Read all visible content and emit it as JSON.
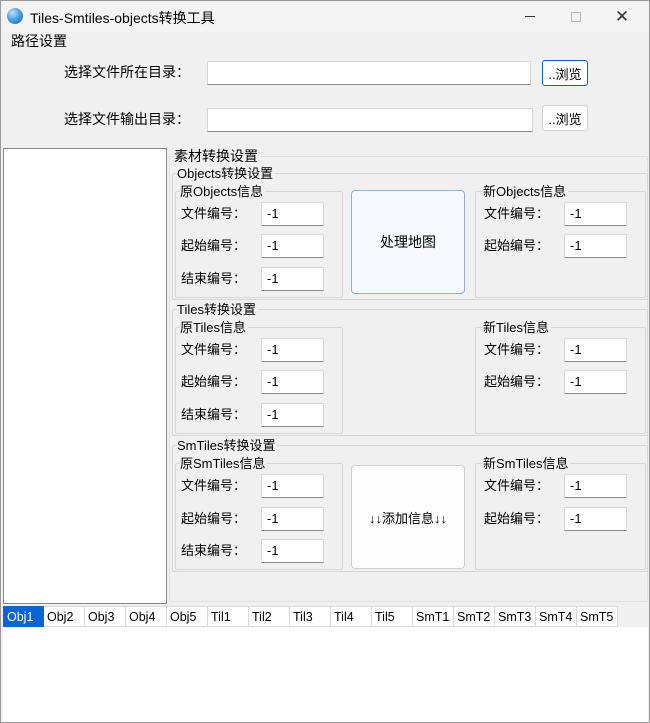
{
  "window": {
    "title": "Tiles-Smtiles-objects转换工具",
    "close_glyph": "✕"
  },
  "path_settings": {
    "group_label": "路径设置",
    "source_dir_label": "选择文件所在目录：",
    "source_dir_value": "",
    "output_dir_label": "选择文件输出目录：",
    "output_dir_value": "",
    "browse_label_1": "..浏览",
    "browse_label_2": "..浏览"
  },
  "material": {
    "group_label": "素材转换设置",
    "field_file_no": "文件编号：",
    "field_start_no": "起始编号：",
    "field_end_no": "结束编号："
  },
  "objects": {
    "group_label": "Objects转换设置",
    "orig_label": "原Objects信息",
    "new_label": "新Objects信息",
    "orig_file_no": "-1",
    "orig_start_no": "-1",
    "orig_end_no": "-1",
    "new_file_no": "-1",
    "new_start_no": "-1",
    "process_button": "处理地图"
  },
  "tiles": {
    "group_label": "Tiles转换设置",
    "orig_label": "原Tiles信息",
    "new_label": "新Tiles信息",
    "orig_file_no": "-1",
    "orig_start_no": "-1",
    "orig_end_no": "-1",
    "new_file_no": "-1",
    "new_start_no": "-1"
  },
  "smtiles": {
    "group_label": "SmTiles转换设置",
    "orig_label": "原SmTiles信息",
    "new_label": "新SmTiles信息",
    "orig_file_no": "-1",
    "orig_start_no": "-1",
    "orig_end_no": "-1",
    "new_file_no": "-1",
    "new_start_no": "-1",
    "add_button": "↓↓添加信息↓↓"
  },
  "tabs": [
    "Obj1",
    "Obj2",
    "Obj3",
    "Obj4",
    "Obj5",
    "Til1",
    "Til2",
    "Til3",
    "Til4",
    "Til5",
    "SmT1",
    "SmT2",
    "SmT3",
    "SmT4",
    "SmT5"
  ],
  "active_tab": "Obj1",
  "colors": {
    "accent": "#0a64d8",
    "window_bg": "#f0f0f0"
  }
}
